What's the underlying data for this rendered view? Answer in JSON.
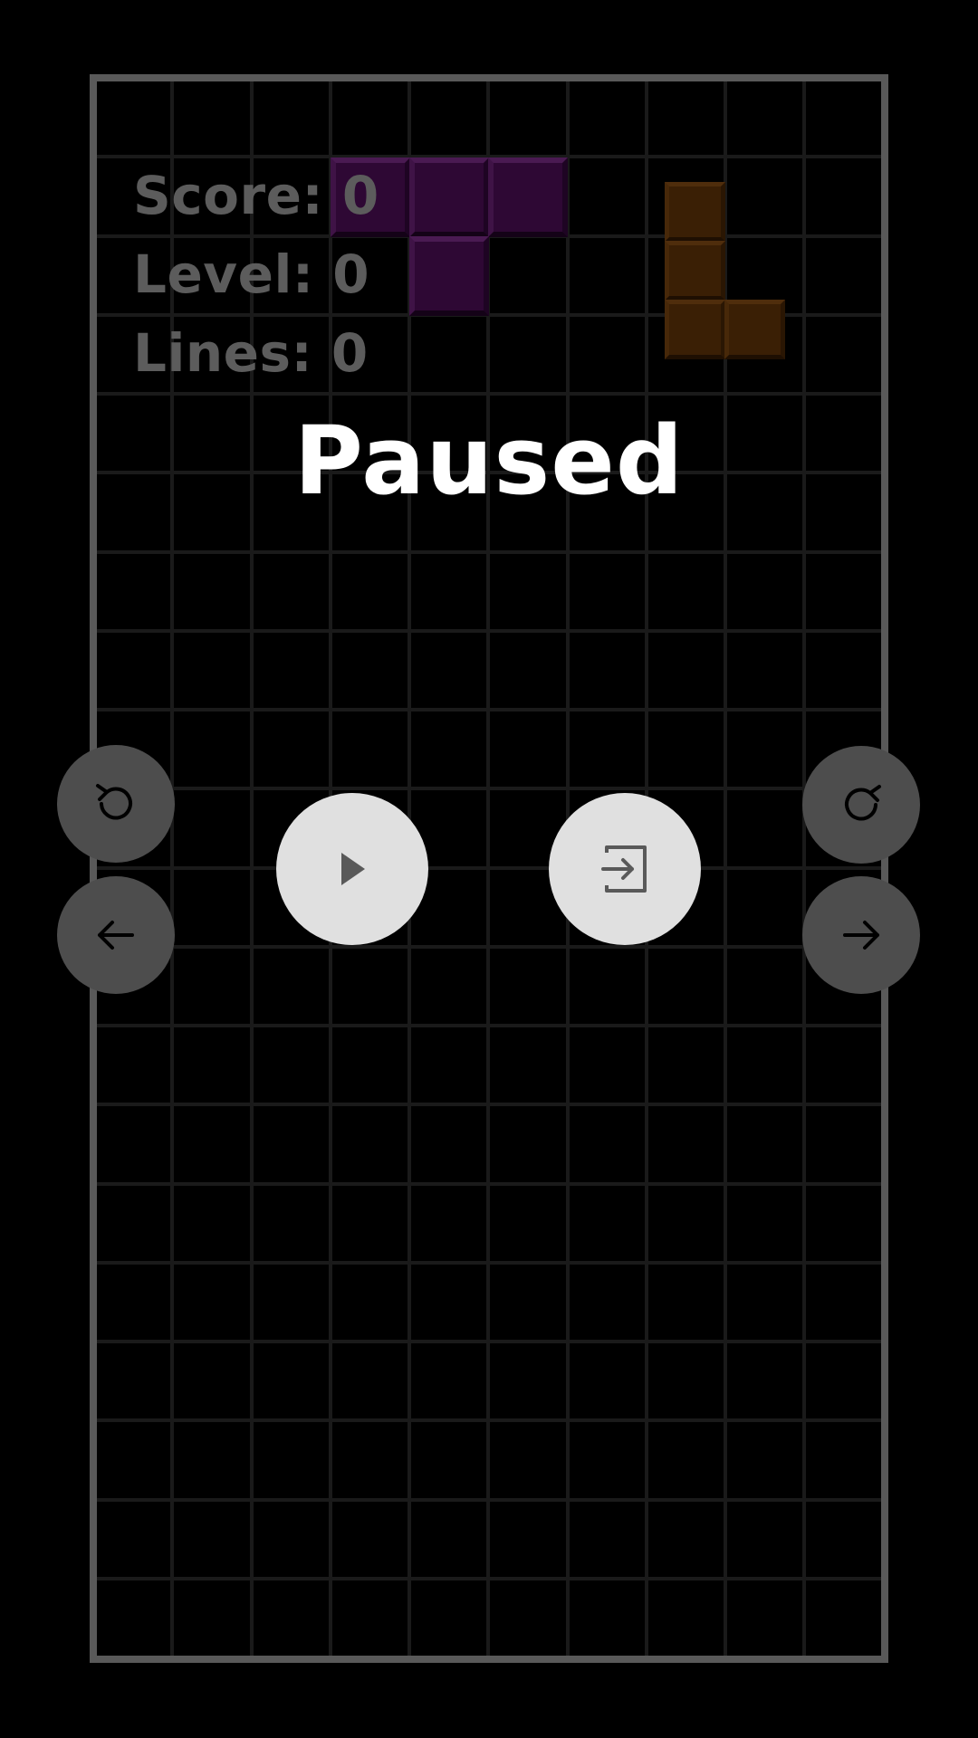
{
  "stats": {
    "score": "Score: 0",
    "level": "Level: 0",
    "lines": "Lines: 0"
  },
  "overlay": {
    "title": "Paused"
  },
  "board": {
    "columns": 10,
    "rows": 20,
    "grid_color": "#1a1a1a",
    "frame_color": "#595959"
  },
  "current_piece": {
    "type": "T",
    "color": "#2e0834"
  },
  "next_piece": {
    "type": "L",
    "color": "#3a1f05"
  },
  "controls": {
    "rotate_left": "rotate-left-icon",
    "rotate_right": "rotate-right-icon",
    "move_left": "arrow-left-icon",
    "move_right": "arrow-right-icon",
    "resume": "play-icon",
    "exit": "exit-icon"
  }
}
